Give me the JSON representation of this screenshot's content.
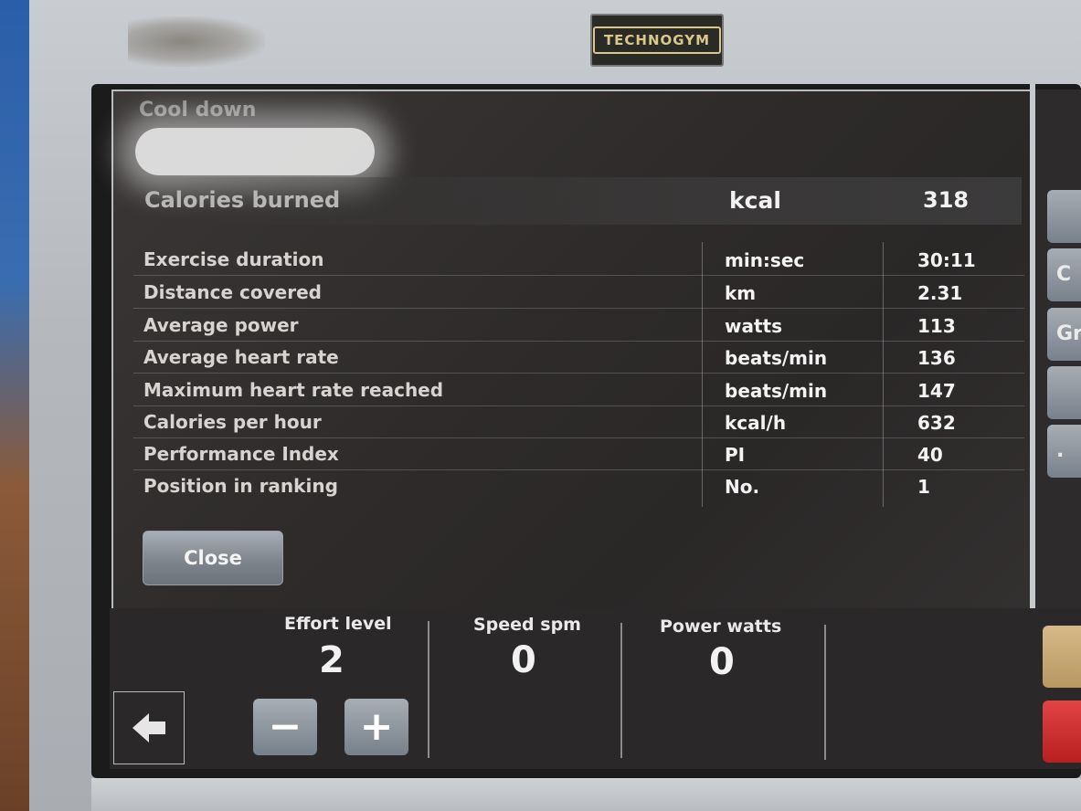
{
  "brand": {
    "logo_text": "TECHNOGYM"
  },
  "dialog": {
    "title": "Cool down",
    "summary": {
      "label": "Calories burned",
      "unit": "kcal",
      "value": "318"
    },
    "rows": [
      {
        "label": "Exercise duration",
        "unit": "min:sec",
        "value": "30:11"
      },
      {
        "label": "Distance covered",
        "unit": "km",
        "value": "2.31"
      },
      {
        "label": "Average power",
        "unit": "watts",
        "value": "113"
      },
      {
        "label": "Average heart rate",
        "unit": "beats/min",
        "value": "136"
      },
      {
        "label": "Maximum heart rate reached",
        "unit": "beats/min",
        "value": "147"
      },
      {
        "label": "Calories per hour",
        "unit": "kcal/h",
        "value": "632"
      },
      {
        "label": "Performance Index",
        "unit": "PI",
        "value": "40"
      },
      {
        "label": "Position in ranking",
        "unit": "No.",
        "value": "1"
      }
    ],
    "close_label": "Close"
  },
  "side_buttons": [
    {
      "label": ""
    },
    {
      "label": "C"
    },
    {
      "label": "Gr"
    },
    {
      "label": ""
    },
    {
      "label": "."
    }
  ],
  "status": {
    "effort": {
      "label": "Effort level",
      "value": "2"
    },
    "speed": {
      "label": "Speed spm",
      "value": "0"
    },
    "power": {
      "label": "Power watts",
      "value": "0"
    },
    "minus_symbol": "−",
    "plus_symbol": "+",
    "back_icon": "arrow-left-icon"
  },
  "colors": {
    "panel_bg": "#2e2b2a",
    "button": "#7e858d",
    "accent_orange": "#c9a86e",
    "accent_red": "#d12f2f"
  }
}
